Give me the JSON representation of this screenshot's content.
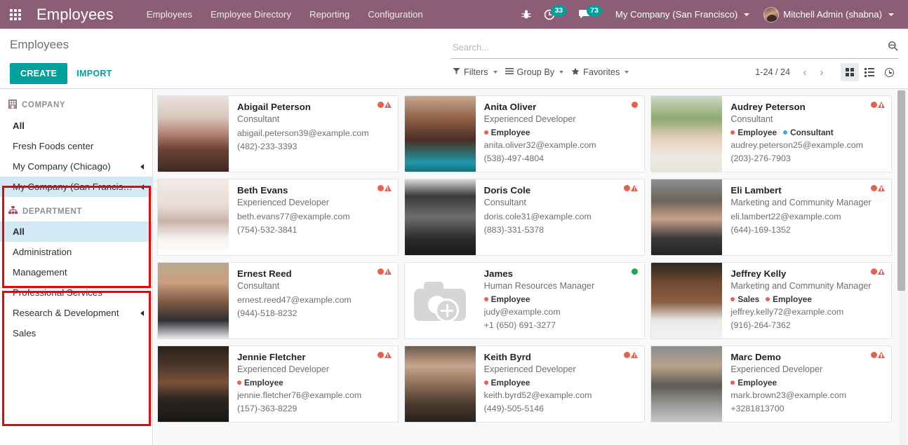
{
  "navbar": {
    "apps_icon": "apps-grid-icon",
    "brand": "Employees",
    "menu": [
      {
        "label": "Employees"
      },
      {
        "label": "Employee Directory"
      },
      {
        "label": "Reporting"
      },
      {
        "label": "Configuration"
      }
    ],
    "bug_icon": "bug-icon",
    "activities": {
      "icon": "clock-icon",
      "count": "33"
    },
    "messages": {
      "icon": "chat-icon",
      "count": "73"
    },
    "company": "My Company (San Francisco)",
    "user": "Mitchell Admin (shabna)"
  },
  "control_panel": {
    "title": "Employees",
    "create_label": "CREATE",
    "import_label": "IMPORT",
    "search": {
      "placeholder": "Search...",
      "value": "",
      "icon": "search-icon"
    },
    "filters_label": "Filters",
    "group_by_label": "Group By",
    "favorites_label": "Favorites",
    "pager": "1-24 / 24",
    "prev_icon": "chevron-left-icon",
    "next_icon": "chevron-right-icon",
    "views": [
      {
        "name": "kanban",
        "icon": "kanban-view-icon",
        "active": true
      },
      {
        "name": "list",
        "icon": "list-view-icon",
        "active": false
      },
      {
        "name": "activity",
        "icon": "activity-view-icon",
        "active": false
      }
    ]
  },
  "sidebar": {
    "company": {
      "title": "COMPANY",
      "icon": "building-icon",
      "items": [
        {
          "label": "All",
          "bold": true,
          "selected": false,
          "expandable": false
        },
        {
          "label": "Fresh Foods center",
          "bold": false,
          "selected": false,
          "expandable": false
        },
        {
          "label": "My Company (Chicago)",
          "bold": false,
          "selected": false,
          "expandable": true
        },
        {
          "label": "My Company (San Francis…",
          "bold": false,
          "selected": true,
          "expandable": true
        }
      ]
    },
    "department": {
      "title": "DEPARTMENT",
      "icon": "sitemap-icon",
      "items": [
        {
          "label": "All",
          "bold": true,
          "selected": true,
          "expandable": false
        },
        {
          "label": "Administration",
          "bold": false,
          "selected": false,
          "expandable": false
        },
        {
          "label": "Management",
          "bold": false,
          "selected": false,
          "expandable": false
        },
        {
          "label": "Professional Services",
          "bold": false,
          "selected": false,
          "expandable": false
        },
        {
          "label": "Research & Development",
          "bold": false,
          "selected": false,
          "expandable": true
        },
        {
          "label": "Sales",
          "bold": false,
          "selected": false,
          "expandable": false
        }
      ]
    }
  },
  "colors": {
    "navbar_purple": "#8b5e76",
    "accent_teal": "#00a09d",
    "status_red": "#e8604e",
    "status_green": "#1cab45",
    "tag_red": "#e8604e",
    "tag_blue": "#4aa3df",
    "selection_blue": "#d3e9f5",
    "annotation_red": "#f30000"
  },
  "employees": [
    {
      "name": "Abigail Peterson",
      "job": "Consultant",
      "tags": [],
      "email": "abigail.peterson39@example.com",
      "phone": "(482)-233-3393",
      "status": "red",
      "warning": true,
      "photo": "photo"
    },
    {
      "name": "Anita Oliver",
      "job": "Experienced Developer",
      "tags": [
        {
          "label": "Employee",
          "color": "#e8604e"
        }
      ],
      "email": "anita.oliver32@example.com",
      "phone": "(538)-497-4804",
      "status": "red",
      "warning": false,
      "photo": "photo"
    },
    {
      "name": "Audrey Peterson",
      "job": "Consultant",
      "tags": [
        {
          "label": "Employee",
          "color": "#e8604e"
        },
        {
          "label": "Consultant",
          "color": "#4aa3df"
        }
      ],
      "email": "audrey.peterson25@example.com",
      "phone": "(203)-276-7903",
      "status": "red",
      "warning": true,
      "photo": "photo"
    },
    {
      "name": "Beth Evans",
      "job": "Experienced Developer",
      "tags": [],
      "email": "beth.evans77@example.com",
      "phone": "(754)-532-3841",
      "status": "red",
      "warning": true,
      "photo": "photo"
    },
    {
      "name": "Doris Cole",
      "job": "Consultant",
      "tags": [],
      "email": "doris.cole31@example.com",
      "phone": "(883)-331-5378",
      "status": "red",
      "warning": true,
      "photo": "photo"
    },
    {
      "name": "Eli Lambert",
      "job": "Marketing and Community Manager",
      "tags": [],
      "email": "eli.lambert22@example.com",
      "phone": "(644)-169-1352",
      "status": "red",
      "warning": true,
      "photo": "photo"
    },
    {
      "name": "Ernest Reed",
      "job": "Consultant",
      "tags": [],
      "email": "ernest.reed47@example.com",
      "phone": "(944)-518-8232",
      "status": "red",
      "warning": true,
      "photo": "photo"
    },
    {
      "name": "James",
      "job": "Human Resources Manager",
      "tags": [
        {
          "label": "Employee",
          "color": "#e8604e"
        }
      ],
      "email": "judy@example.com",
      "phone": "+1 (650) 691-3277",
      "status": "green",
      "warning": false,
      "photo": "placeholder"
    },
    {
      "name": "Jeffrey Kelly",
      "job": "Marketing and Community Manager",
      "tags": [
        {
          "label": "Sales",
          "color": "#e8604e"
        },
        {
          "label": "Employee",
          "color": "#e8604e"
        }
      ],
      "email": "jeffrey.kelly72@example.com",
      "phone": "(916)-264-7362",
      "status": "red",
      "warning": true,
      "photo": "photo"
    },
    {
      "name": "Jennie Fletcher",
      "job": "Experienced Developer",
      "tags": [
        {
          "label": "Employee",
          "color": "#e8604e"
        }
      ],
      "email": "jennie.fletcher76@example.com",
      "phone": "(157)-363-8229",
      "status": "red",
      "warning": true,
      "photo": "photo"
    },
    {
      "name": "Keith Byrd",
      "job": "Experienced Developer",
      "tags": [
        {
          "label": "Employee",
          "color": "#e8604e"
        }
      ],
      "email": "keith.byrd52@example.com",
      "phone": "(449)-505-5146",
      "status": "red",
      "warning": true,
      "photo": "photo"
    },
    {
      "name": "Marc Demo",
      "job": "Experienced Developer",
      "tags": [
        {
          "label": "Employee",
          "color": "#e8604e"
        }
      ],
      "email": "mark.brown23@example.com",
      "phone": "+3281813700",
      "status": "red",
      "warning": true,
      "photo": "photo"
    }
  ]
}
